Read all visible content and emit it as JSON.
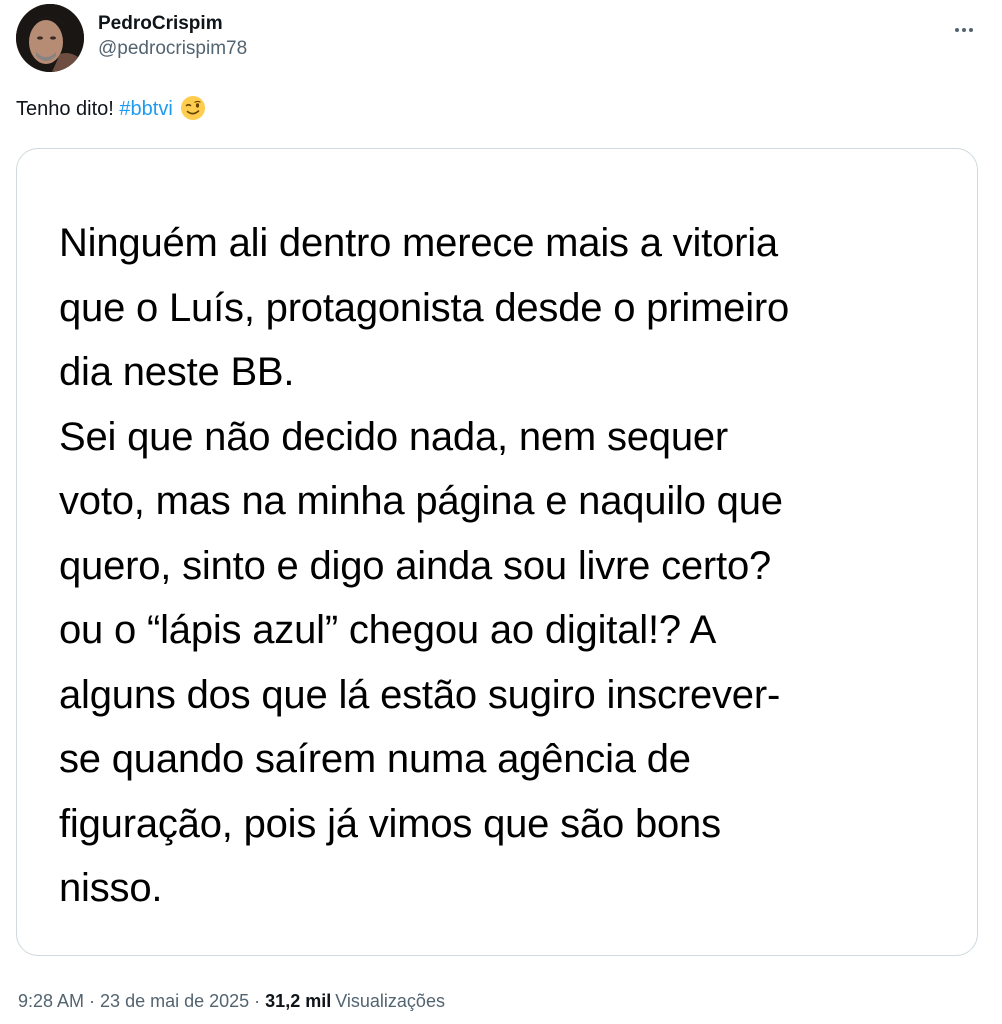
{
  "author": {
    "display_name": "PedroCrispim",
    "handle": "@pedrocrispim78"
  },
  "more_icon": "more-horizontal-icon",
  "tweet": {
    "text": "Tenho dito! ",
    "hashtag": "#bbtvi",
    "emoji": "winking-face"
  },
  "image": {
    "lines": [
      "Ninguém ali dentro merece mais a vitoria",
      "que o Luís, protagonista desde o primeiro",
      "dia neste BB.",
      "Sei que não decido nada, nem sequer",
      "voto, mas na minha página e naquilo que",
      "quero, sinto e digo ainda sou livre certo?",
      "ou o “lápis azul” chegou ao digital!? A",
      "alguns dos que lá estão sugiro inscrever-",
      "se quando saírem numa agência de",
      "figuração, pois já vimos que são bons",
      "nisso."
    ]
  },
  "meta": {
    "time": "9:28 AM",
    "separator": "·",
    "date": "23 de mai de 2025",
    "views_count": "31,2 mil",
    "views_label": "Visualizações"
  },
  "colors": {
    "text": "#0f1419",
    "secondary": "#536471",
    "link": "#1d9bf0",
    "border": "#cfd9de"
  }
}
